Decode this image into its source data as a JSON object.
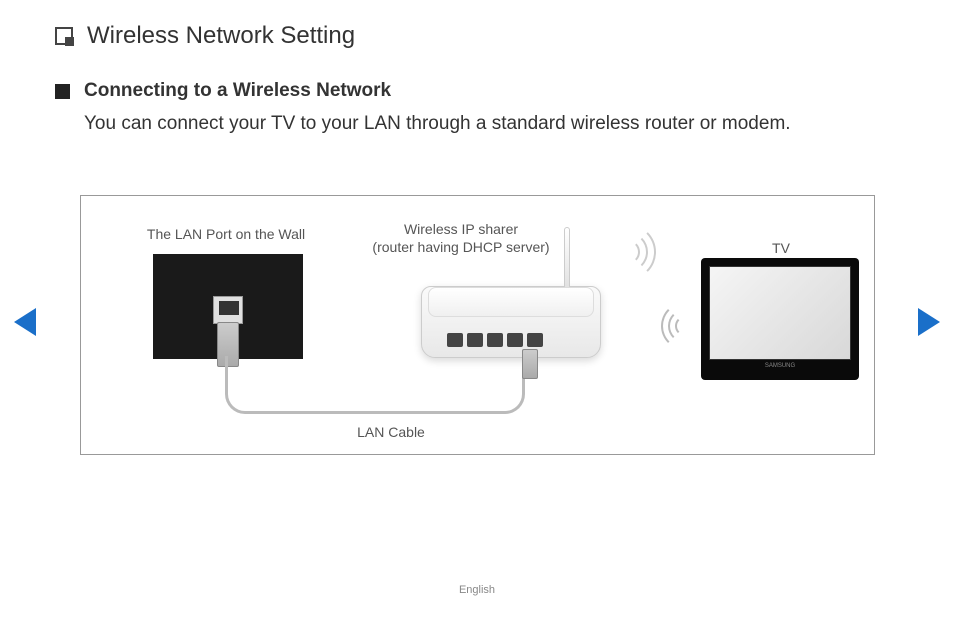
{
  "page": {
    "title": "Wireless Network Setting",
    "language": "English"
  },
  "section": {
    "heading": "Connecting to a Wireless Network",
    "description": "You can connect your TV to your LAN through a standard wireless router or modem."
  },
  "diagram": {
    "labels": {
      "wall_port": "The LAN Port on the Wall",
      "router_line1": "Wireless IP sharer",
      "router_line2": "(router having DHCP server)",
      "tv": "TV",
      "cable": "LAN Cable"
    },
    "tv_brand": "SAMSUNG"
  },
  "nav": {
    "prev": "Previous",
    "next": "Next"
  }
}
